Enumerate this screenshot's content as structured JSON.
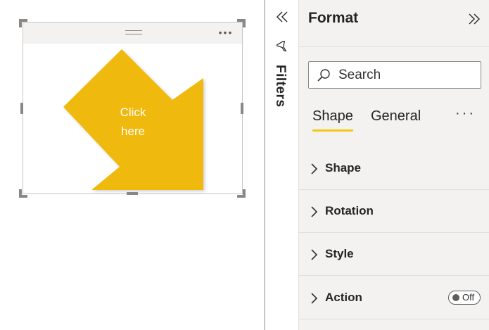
{
  "canvas": {
    "shape": {
      "label_line1": "Click",
      "label_line2": "here",
      "fill_color": "#F0B90A",
      "header_more": "•••"
    }
  },
  "filters": {
    "label": "Filters"
  },
  "format_pane": {
    "title": "Format",
    "search": {
      "placeholder": "Search"
    },
    "tabs": [
      {
        "label": "Shape",
        "active": true
      },
      {
        "label": "General",
        "active": false
      }
    ],
    "tabs_more": "···",
    "sections": [
      {
        "label": "Shape"
      },
      {
        "label": "Rotation"
      },
      {
        "label": "Style"
      },
      {
        "label": "Action",
        "toggle": "Off"
      }
    ],
    "accent_color": "#F2C811"
  }
}
